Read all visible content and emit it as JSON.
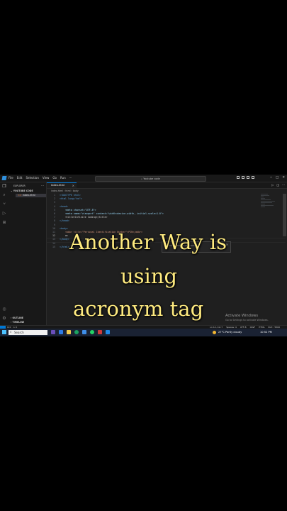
{
  "titlebar": {
    "menu": [
      "File",
      "Edit",
      "Selection",
      "View",
      "Go",
      "Run",
      "···"
    ],
    "search": "Youtube code"
  },
  "sidebar": {
    "title": "EXPLORER",
    "section": "YOUTUBE CODE",
    "file": "index.html",
    "outline": "OUTLINE",
    "timeline": "TIMELINE"
  },
  "editor": {
    "tab_label": "index.html",
    "breadcrumb": "index.html › html › body",
    "lines": [
      {
        "n": "1",
        "code": "<!DOCTYPE html>"
      },
      {
        "n": "2",
        "code": "<html lang=\"en\">"
      },
      {
        "n": "3",
        "code": ""
      },
      {
        "n": "4",
        "code": "<head>"
      },
      {
        "n": "5",
        "code": "    <meta charset=\"UTF-8\">"
      },
      {
        "n": "6",
        "code": "    <meta name=\"viewport\" content=\"width=device-width, initial-scale=1.0\">"
      },
      {
        "n": "7",
        "code": "    <title>Infinite Coding</title>"
      },
      {
        "n": "8",
        "code": "</head>"
      },
      {
        "n": "9",
        "code": ""
      },
      {
        "n": "10",
        "code": "<body>"
      },
      {
        "n": "11",
        "code": "    <abbr title=\"Personal Identification Number\">PIN</abbr>"
      },
      {
        "n": "12",
        "code": "    ac"
      },
      {
        "n": "13",
        "code": "</body>"
      },
      {
        "n": "14",
        "code": ""
      },
      {
        "n": "15",
        "code": "</html>"
      }
    ],
    "suggestion": "acronym Emmet Abbreviation"
  },
  "watermark": {
    "line1": "Activate Windows",
    "line2": "Go to Settings to activate Windows."
  },
  "statusbar": {
    "left": [
      "⊗ 0",
      "⚠ 0"
    ],
    "right": [
      "Ln 12, Col 7",
      "Spaces: 4",
      "UTF-8",
      "CRLF",
      "HTML",
      "Port : 5500"
    ]
  },
  "taskbar": {
    "search": "Search",
    "weather": "27°C  Partly cloudy",
    "time": "10:52 PM"
  },
  "caption": {
    "line1": "Another Way is",
    "line2": "using",
    "line3": "acronym  tag"
  },
  "colors": {
    "accent": "#0078d4",
    "caption": "#ffeb80",
    "editor_bg": "#1f1f1f"
  }
}
